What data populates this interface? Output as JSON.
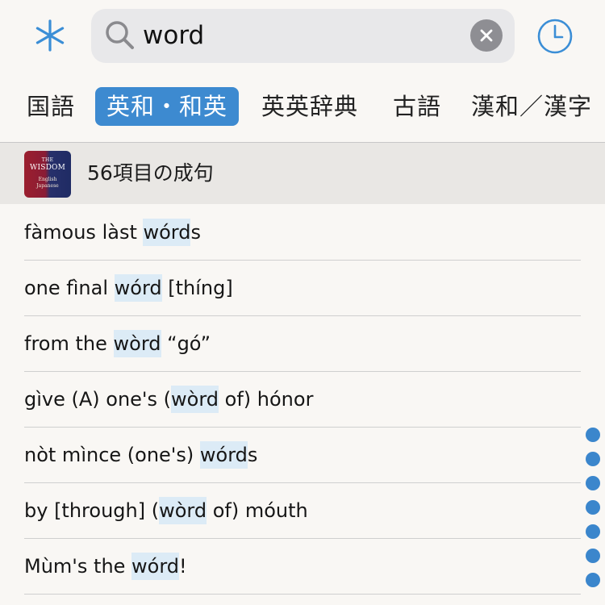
{
  "search": {
    "query": "word",
    "placeholder": ""
  },
  "tabs": [
    {
      "label": "国語",
      "active": false
    },
    {
      "label": "英和・和英",
      "active": true
    },
    {
      "label": "英英辞典",
      "active": false
    },
    {
      "label": "古語",
      "active": false
    },
    {
      "label": "漢和／漢字",
      "active": false
    }
  ],
  "section": {
    "book_cover": {
      "line1": "THE",
      "line2": "WISDOM",
      "line3": "English",
      "line4": "Japanese"
    },
    "title": "56項目の成句"
  },
  "results": [
    {
      "before": "fàmous làst ",
      "highlight": "wórd",
      "after": "s"
    },
    {
      "before": "one fìnal ",
      "highlight": "wórd",
      "after": " [thíng]"
    },
    {
      "before": "from the ",
      "highlight": "wòrd",
      "after": " “gó”"
    },
    {
      "before": "gìve (A) one's (",
      "highlight": "wòrd",
      "after": " of) hónor"
    },
    {
      "before": "nòt mìnce (one's) ",
      "highlight": "wórd",
      "after": "s"
    },
    {
      "before": "by [through] (",
      "highlight": "wòrd",
      "after": " of) móuth"
    },
    {
      "before": "Mùm's the ",
      "highlight": "wórd",
      "after": "!"
    }
  ],
  "index_dots": 7,
  "colors": {
    "accent": "#3d8ad0",
    "highlight": "#dcebf6",
    "background": "#f9f7f4",
    "header_bg": "#e9e7e4"
  },
  "icons": {
    "menu": "asterisk-icon",
    "search": "search-icon",
    "clear": "clear-icon",
    "history": "clock-icon"
  }
}
